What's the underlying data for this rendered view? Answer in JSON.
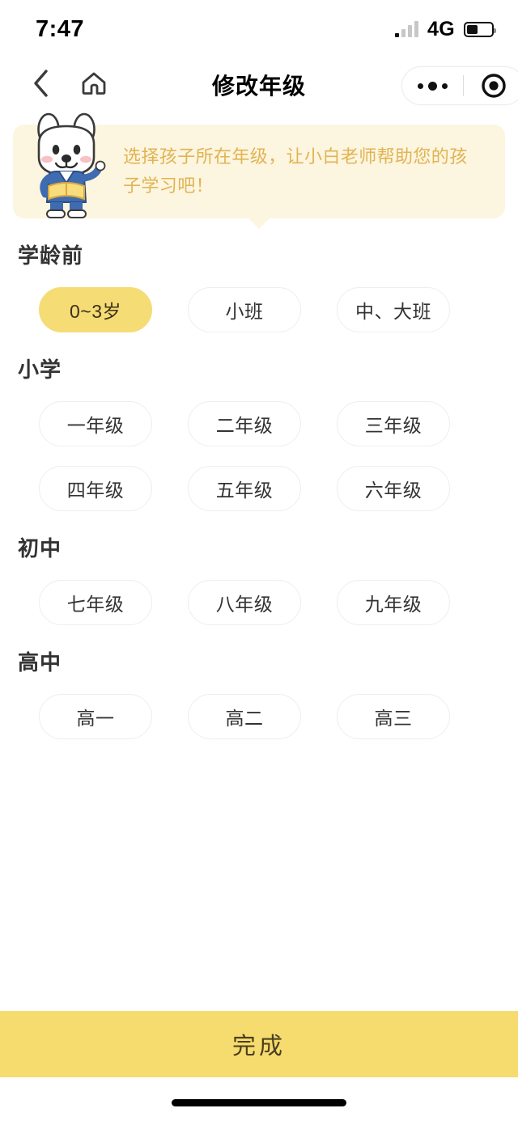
{
  "status_bar": {
    "time": "7:47",
    "network": "4G",
    "battery_level_pct": 45
  },
  "nav": {
    "title": "修改年级",
    "back_icon": "chevron-left-icon",
    "home_icon": "home-icon",
    "capsule_more_icon": "more-dots-icon",
    "capsule_target_icon": "target-circle-icon"
  },
  "banner": {
    "text": "选择孩子所在年级，让小白老师帮助您的孩子学习吧！",
    "mascot_icon": "dog-mascot-icon",
    "background_color": "#FCF5E0",
    "text_color": "#E1B452"
  },
  "sections": [
    {
      "title": "学龄前",
      "options": [
        {
          "label": "0~3岁",
          "selected": true
        },
        {
          "label": "小班",
          "selected": false
        },
        {
          "label": "中、大班",
          "selected": false
        }
      ]
    },
    {
      "title": "小学",
      "options": [
        {
          "label": "一年级",
          "selected": false
        },
        {
          "label": "二年级",
          "selected": false
        },
        {
          "label": "三年级",
          "selected": false
        },
        {
          "label": "四年级",
          "selected": false
        },
        {
          "label": "五年级",
          "selected": false
        },
        {
          "label": "六年级",
          "selected": false
        }
      ]
    },
    {
      "title": "初中",
      "options": [
        {
          "label": "七年级",
          "selected": false
        },
        {
          "label": "八年级",
          "selected": false
        },
        {
          "label": "九年级",
          "selected": false
        }
      ]
    },
    {
      "title": "高中",
      "options": [
        {
          "label": "高一",
          "selected": false
        },
        {
          "label": "高二",
          "selected": false
        },
        {
          "label": "高三",
          "selected": false
        }
      ]
    }
  ],
  "footer": {
    "submit_label": "完成",
    "button_color": "#F6DB6E"
  },
  "colors": {
    "accent": "#F5DC75",
    "chip_border": "#eeeeee",
    "heading": "#333333"
  }
}
